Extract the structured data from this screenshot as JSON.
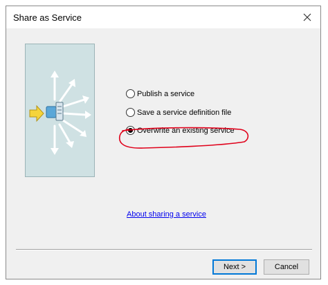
{
  "window": {
    "title": "Share as Service",
    "close_icon": "close-icon"
  },
  "illustration": {
    "icon": "share-service-illustration"
  },
  "options": [
    {
      "label": "Publish a service",
      "selected": false
    },
    {
      "label": "Save a service definition file",
      "selected": false
    },
    {
      "label": "Overwrite an existing service",
      "selected": true
    }
  ],
  "annotation": {
    "color": "#e0001a"
  },
  "help_link": "About sharing a service",
  "buttons": {
    "next_label": "Next >",
    "cancel_label": "Cancel"
  },
  "colors": {
    "link": "#0000ee",
    "default_button_border": "#0078d7",
    "illustration_bg": "#cfe1e3"
  }
}
